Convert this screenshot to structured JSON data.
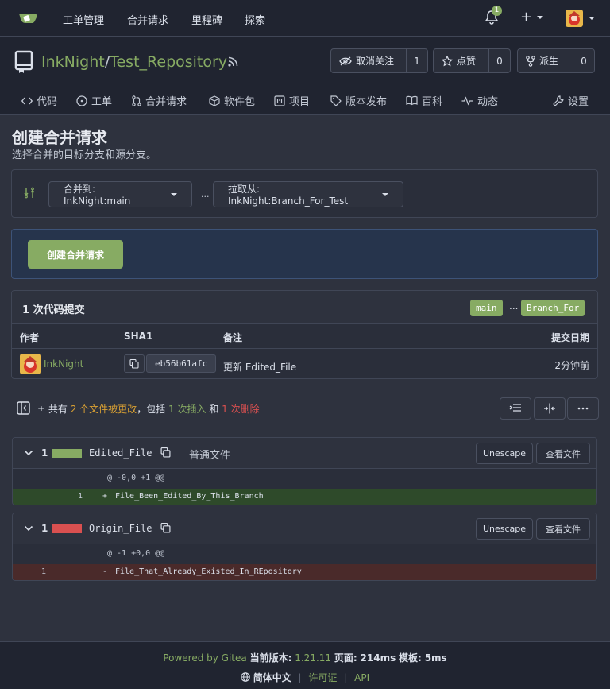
{
  "nav": {
    "items": [
      "工单管理",
      "合并请求",
      "里程碑",
      "探索"
    ],
    "notification_count": "1",
    "plus": "+"
  },
  "repo": {
    "owner": "InkNight",
    "separator": "/",
    "name": "Test_Repository",
    "unwatch_label": "取消关注",
    "watch_count": "1",
    "star_label": "点赞",
    "star_count": "0",
    "fork_label": "派生",
    "fork_count": "0"
  },
  "tabs": [
    "代码",
    "工单",
    "合并请求",
    "软件包",
    "项目",
    "版本发布",
    "百科",
    "动态",
    "设置"
  ],
  "page": {
    "title": "创建合并请求",
    "subtitle": "选择合并的目标分支和源分支。"
  },
  "branches": {
    "base_label": "合并到: InkNight:main",
    "dots": "...",
    "head_label": "拉取从: InkNight:Branch_For_Test"
  },
  "create_button": "创建合并请求",
  "commits": {
    "count_label": "1 次代码提交",
    "base_branch": "main",
    "ellipsis": "...",
    "head_branch": "Branch_For",
    "headers": {
      "author": "作者",
      "sha": "SHA1",
      "message": "备注",
      "date": "提交日期"
    },
    "rows": [
      {
        "author": "InkNight",
        "sha": "eb56b61afc",
        "message": "更新 Edited_File",
        "date": "2分钟前"
      }
    ]
  },
  "diff_summary": {
    "prefix": "共有",
    "files_changed": "2 个文件被更改",
    "mid": "，包括",
    "additions": "1 次插入",
    "and": "和",
    "deletions": "1 次删除"
  },
  "files": [
    {
      "count": "1",
      "name": "Edited_File",
      "type_label": "普通文件",
      "unescape": "Unescape",
      "view_file": "查看文件",
      "hunk": "@ -0,0 +1 @@",
      "line_no": "1",
      "sign": "+",
      "line_text": "File_Been_Edited_By_This_Branch",
      "status": "added"
    },
    {
      "count": "1",
      "name": "Origin_File",
      "unescape": "Unescape",
      "view_file": "查看文件",
      "hunk": "@ -1 +0,0 @@",
      "line_no": "1",
      "sign": "-",
      "line_text": "File_That_Already_Existed_In_REpository",
      "status": "deleted"
    }
  ],
  "footer": {
    "powered": "Powered by Gitea",
    "version_label": "当前版本:",
    "version": "1.21.11",
    "page_label": "页面:",
    "page_time": "214ms",
    "template_label": "模板:",
    "template_time": "5ms",
    "language": "简体中文",
    "license": "许可证",
    "api": "API"
  },
  "colors": {
    "accent_green": "#87ab63",
    "delete_red": "#d95050",
    "added_line_bg": "#2e4a2a",
    "deleted_line_bg": "#4a2a2a"
  }
}
